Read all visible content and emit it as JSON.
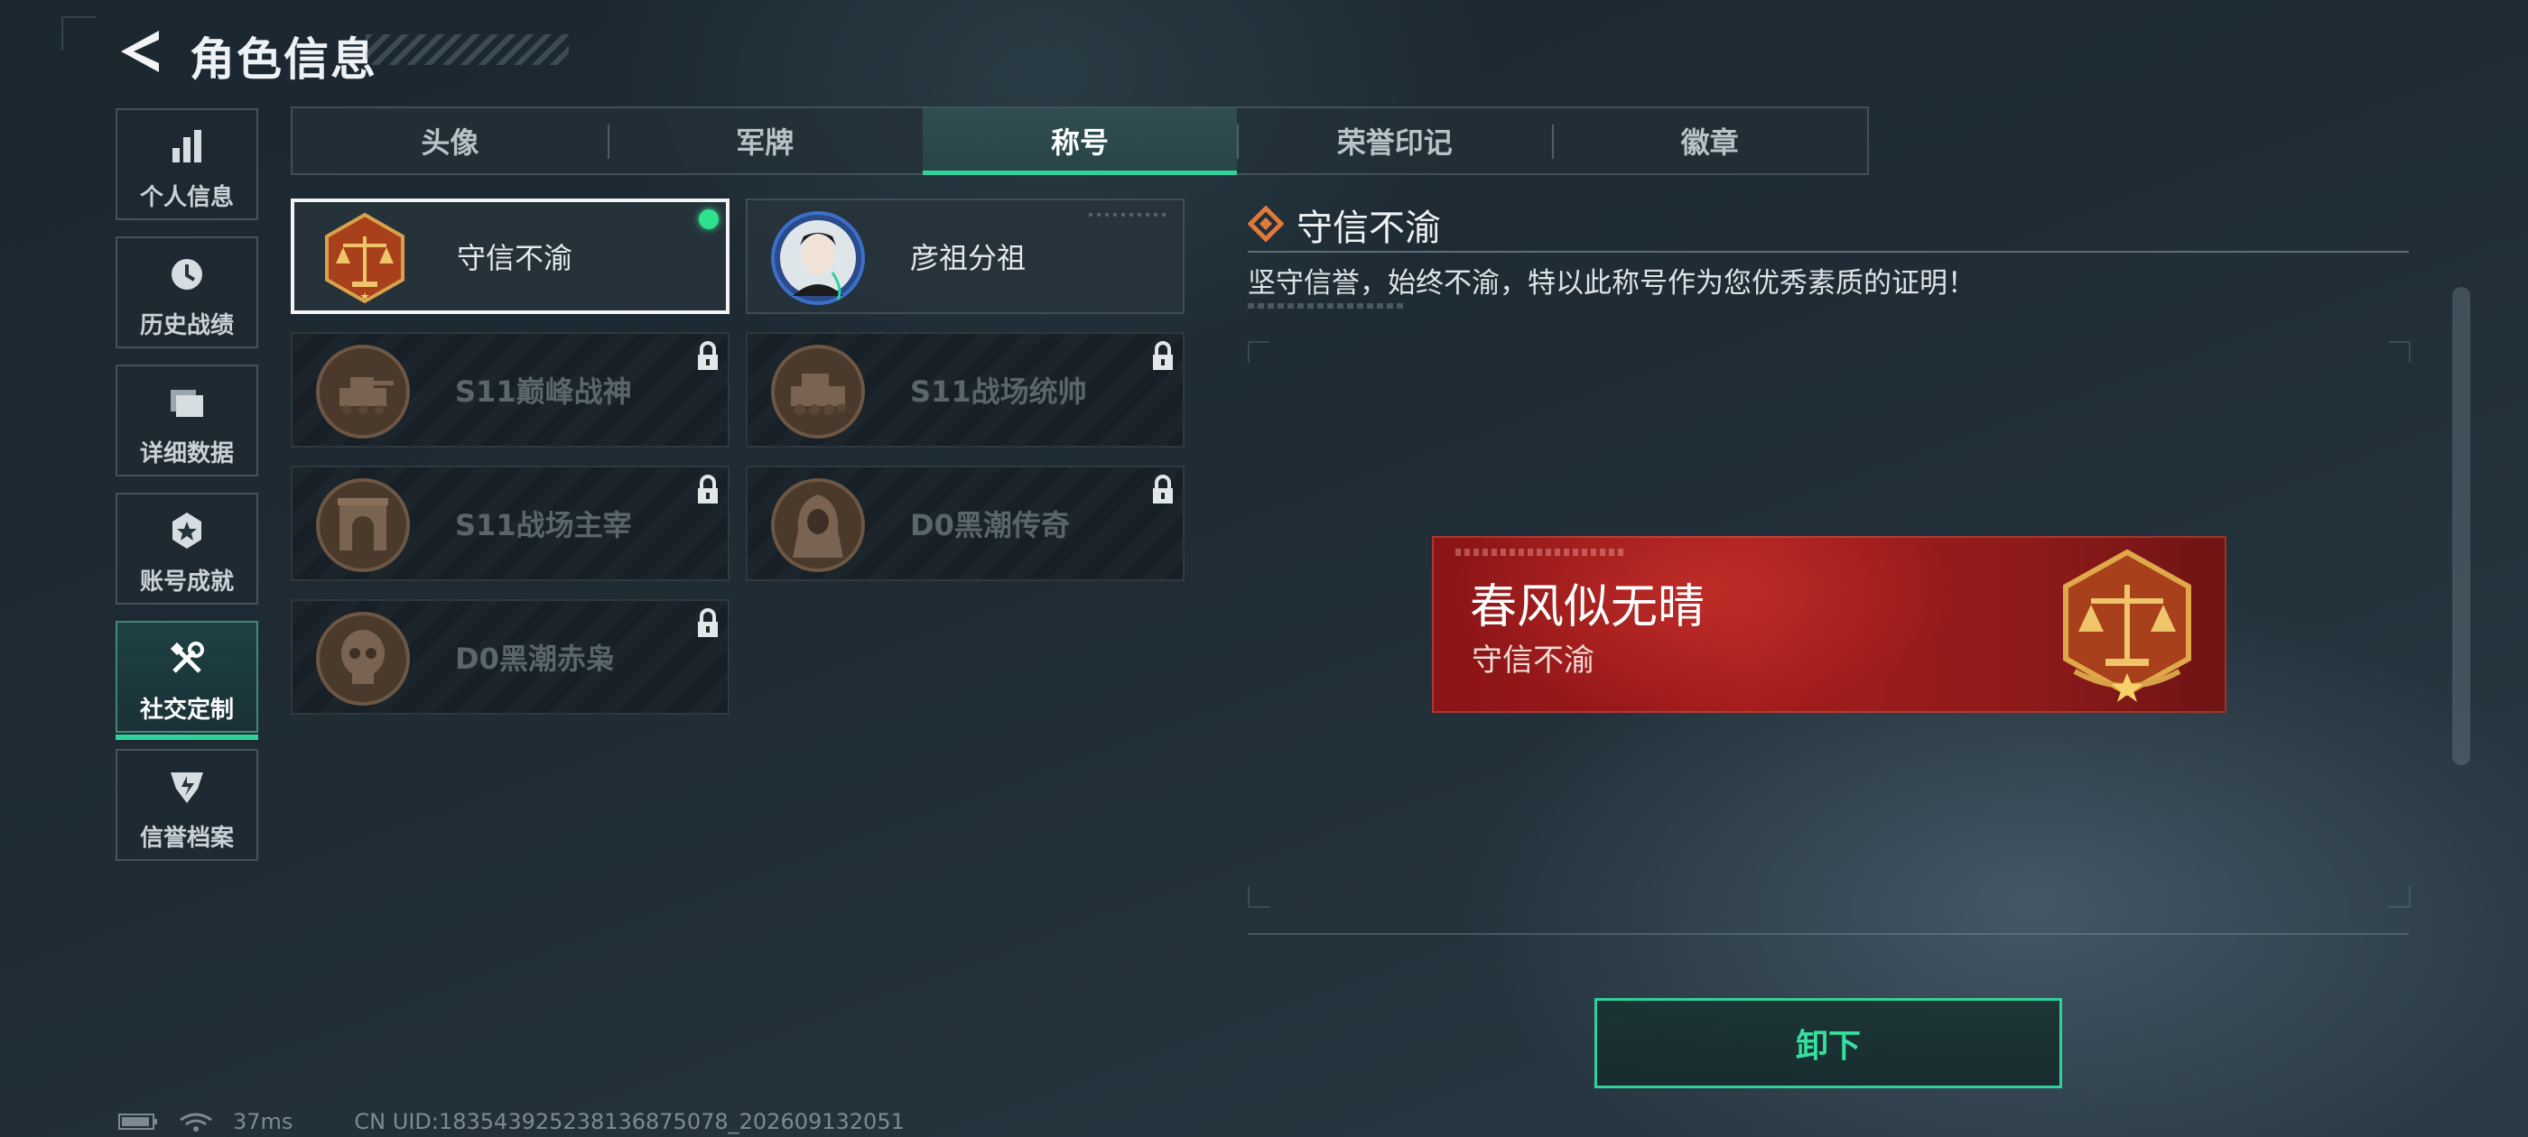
{
  "header": {
    "title": "角色信息"
  },
  "nav": {
    "items": [
      {
        "label": "个人信息",
        "icon": "bar-chart-icon",
        "active": false
      },
      {
        "label": "历史战绩",
        "icon": "history-clock-icon",
        "active": false
      },
      {
        "label": "详细数据",
        "icon": "folder-stack-icon",
        "active": false
      },
      {
        "label": "账号成就",
        "icon": "achievement-badge-icon",
        "active": false
      },
      {
        "label": "社交定制",
        "icon": "tools-icon",
        "active": true
      },
      {
        "label": "信誉档案",
        "icon": "credit-shield-icon",
        "active": false
      }
    ]
  },
  "tabs": [
    {
      "label": "头像",
      "active": false
    },
    {
      "label": "军牌",
      "active": false
    },
    {
      "label": "称号",
      "active": true
    },
    {
      "label": "荣誉印记",
      "active": false
    },
    {
      "label": "徽章",
      "active": false
    }
  ],
  "titles": [
    {
      "label": "守信不渝",
      "icon": "scales-medal-icon",
      "state": "equipped"
    },
    {
      "label": "彦祖分祖",
      "icon": "portrait-medal-icon",
      "state": "owned"
    },
    {
      "label": "S11巅峰战神",
      "icon": "tank-medal-icon",
      "state": "locked"
    },
    {
      "label": "S11战场统帅",
      "icon": "armored-vehicle-medal-icon",
      "state": "locked"
    },
    {
      "label": "S11战场主宰",
      "icon": "arch-medal-icon",
      "state": "locked"
    },
    {
      "label": "D0黑潮传奇",
      "icon": "hooded-figure-medal-icon",
      "state": "locked"
    },
    {
      "label": "D0黑潮赤枭",
      "icon": "skull-medal-icon",
      "state": "locked"
    }
  ],
  "detail": {
    "title": "守信不渝",
    "description": "坚守信誉，始终不渝，特以此称号作为您优秀素质的证明！"
  },
  "preview": {
    "player_name": "春风似无晴",
    "title": "守信不渝"
  },
  "actions": {
    "unequip_label": "卸下"
  },
  "status": {
    "ping": "37ms",
    "uid": "CN UID:1835439252381368750​78_202609132051"
  },
  "colors": {
    "accent": "#2fd29a",
    "plate": "#a41d1d",
    "equipped_dot": "#2fe08e"
  }
}
